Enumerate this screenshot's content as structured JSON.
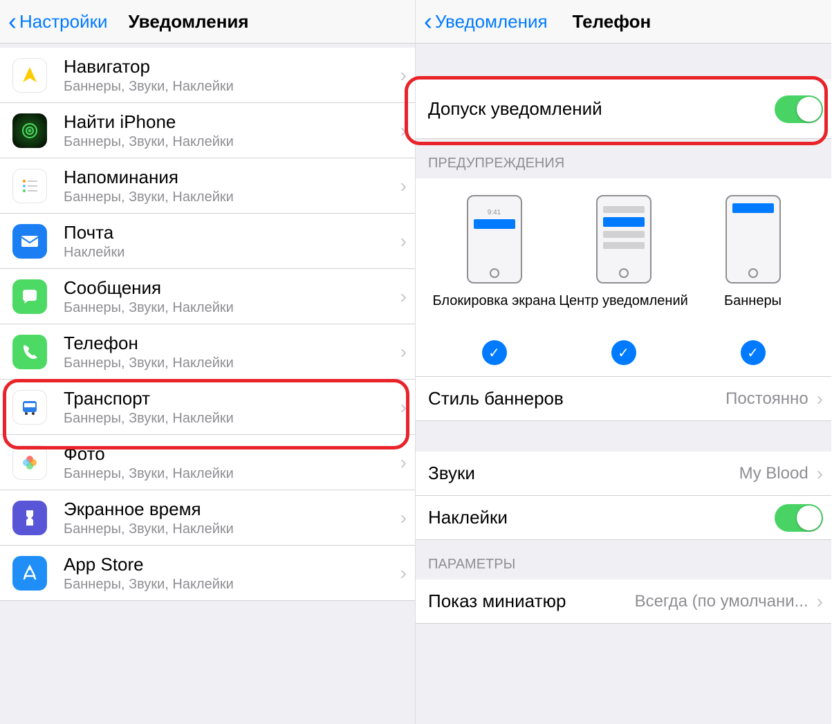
{
  "left": {
    "back": "Настройки",
    "title": "Уведомления",
    "apps": [
      {
        "id": "navigator",
        "name": "Навигатор",
        "sub": "Баннеры, Звуки, Наклейки"
      },
      {
        "id": "findiphone",
        "name": "Найти iPhone",
        "sub": "Баннеры, Звуки, Наклейки"
      },
      {
        "id": "reminders",
        "name": "Напоминания",
        "sub": "Баннеры, Звуки, Наклейки"
      },
      {
        "id": "mail",
        "name": "Почта",
        "sub": "Наклейки"
      },
      {
        "id": "messages",
        "name": "Сообщения",
        "sub": "Баннеры, Звуки, Наклейки"
      },
      {
        "id": "phone",
        "name": "Телефон",
        "sub": "Баннеры, Звуки, Наклейки"
      },
      {
        "id": "transport",
        "name": "Транспорт",
        "sub": "Баннеры, Звуки, Наклейки"
      },
      {
        "id": "photos",
        "name": "Фото",
        "sub": "Баннеры, Звуки, Наклейки"
      },
      {
        "id": "screentime",
        "name": "Экранное время",
        "sub": "Баннеры, Звуки, Наклейки"
      },
      {
        "id": "appstore",
        "name": "App Store",
        "sub": "Баннеры, Звуки, Наклейки"
      }
    ]
  },
  "right": {
    "back": "Уведомления",
    "title": "Телефон",
    "allow_label": "Допуск уведомлений",
    "alerts_header": "ПРЕДУПРЕЖДЕНИЯ",
    "alert_options": {
      "lock": "Блокировка экрана",
      "center": "Центр уведомлений",
      "banners": "Баннеры",
      "lock_time": "9:41"
    },
    "banner_style": {
      "label": "Стиль баннеров",
      "value": "Постоянно"
    },
    "sounds": {
      "label": "Звуки",
      "value": "My Blood"
    },
    "stickers": {
      "label": "Наклейки"
    },
    "params_header": "ПАРАМЕТРЫ",
    "miniatures": {
      "label": "Показ миниатюр",
      "value": "Всегда (по умолчани..."
    }
  }
}
